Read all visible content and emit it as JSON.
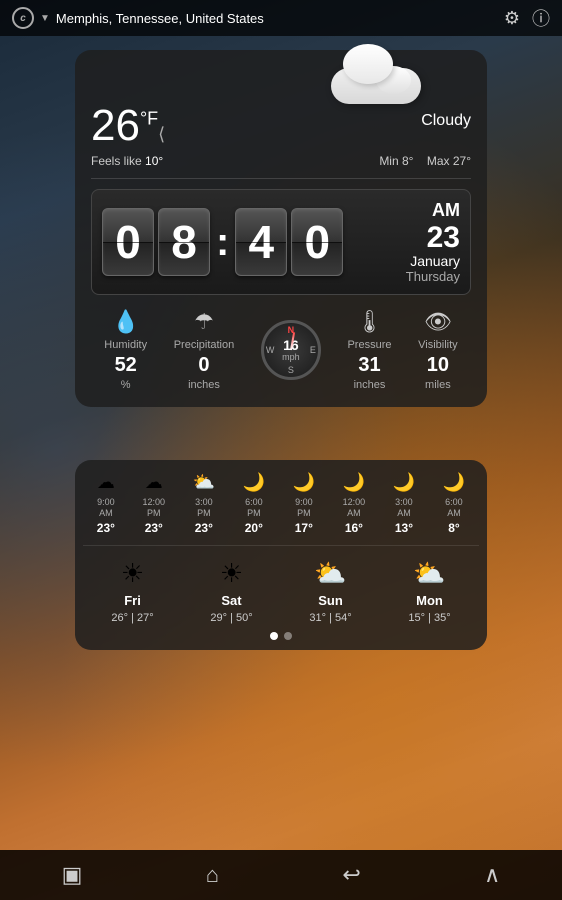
{
  "app": {
    "location": "Memphis, Tennessee, United States"
  },
  "weather": {
    "temperature": "26",
    "unit": "°F",
    "condition": "Cloudy",
    "feels_like_label": "Feels like",
    "feels_like": "10°",
    "min_label": "Min",
    "min_temp": "8°",
    "max_label": "Max",
    "max_temp": "27°"
  },
  "clock": {
    "hour1": "0",
    "hour2": "8",
    "min1": "4",
    "min2": "0",
    "ampm": "AM",
    "day": "23",
    "month": "January",
    "weekday": "Thursday"
  },
  "stats": {
    "humidity_label": "Humidity",
    "humidity_value": "52",
    "humidity_unit": "%",
    "precipitation_label": "Precipitation",
    "precipitation_value": "0",
    "precipitation_unit": "inches",
    "wind_speed": "16",
    "wind_unit": "mph",
    "wind_dirs": [
      "N",
      "W",
      "E",
      "S"
    ],
    "pressure_label": "Pressure",
    "pressure_value": "31",
    "pressure_unit": "inches",
    "visibility_label": "Visibility",
    "visibility_value": "10",
    "visibility_unit": "miles"
  },
  "hourly": [
    {
      "time": "9:00\nAM",
      "temp": "23°",
      "icon": "cloudy"
    },
    {
      "time": "12:00\nPM",
      "temp": "23°",
      "icon": "cloudy"
    },
    {
      "time": "3:00\nPM",
      "temp": "23°",
      "icon": "partly"
    },
    {
      "time": "6:00\nPM",
      "temp": "20°",
      "icon": "moon"
    },
    {
      "time": "9:00\nPM",
      "temp": "17°",
      "icon": "moon"
    },
    {
      "time": "12:00\nAM",
      "temp": "16°",
      "icon": "moon"
    },
    {
      "time": "3:00\nAM",
      "temp": "13°",
      "icon": "moon"
    },
    {
      "time": "6:00\nAM",
      "temp": "8°",
      "icon": "moon"
    }
  ],
  "daily": [
    {
      "name": "Fri",
      "lo": "26°",
      "hi": "27°",
      "icon": "sunny"
    },
    {
      "name": "Sat",
      "lo": "29°",
      "hi": "50°",
      "icon": "sunny"
    },
    {
      "name": "Sun",
      "lo": "31°",
      "hi": "54°",
      "icon": "partly"
    },
    {
      "name": "Mon",
      "lo": "15°",
      "hi": "35°",
      "icon": "partly"
    }
  ],
  "nav": {
    "recent_icon": "▣",
    "home_icon": "⌂",
    "back_icon": "↩",
    "overflow_icon": "∧"
  }
}
